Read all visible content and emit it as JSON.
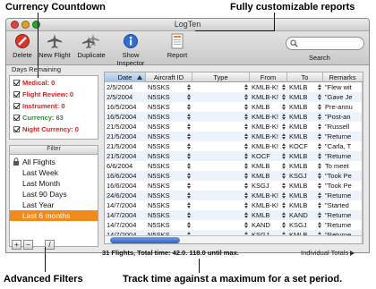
{
  "callouts": {
    "currency": "Currency Countdown",
    "custom_reports": "Fully customizable reports",
    "filters": "Advanced Filters",
    "track": "Track time against a maximum for a set period."
  },
  "window": {
    "title": "LogTen"
  },
  "toolbar": {
    "buttons": [
      {
        "label": "Delete",
        "icon": "delete-icon"
      },
      {
        "label": "New Flight",
        "icon": "airplane-icon"
      },
      {
        "label": "Duplicate",
        "icon": "duplicate-airplane-icon"
      },
      {
        "label": "Show Inspector",
        "icon": "info-icon"
      },
      {
        "label": "Report",
        "icon": "report-icon"
      }
    ],
    "search_label": "Search",
    "search_placeholder": "",
    "colors": {
      "delete": "#d9362b",
      "info": "#2f6fd1",
      "report": "#e8853a"
    }
  },
  "currency": {
    "heading": "Days Remaining",
    "items": [
      {
        "label": "Medical: 0",
        "color": "#d62020"
      },
      {
        "label": "Flight Review: 0",
        "color": "#d62020"
      },
      {
        "label": "Instrument: 0",
        "color": "#d62020"
      },
      {
        "label": "Currency: 63",
        "color": "#2f8a2f"
      },
      {
        "label": "Night Currency: 0",
        "color": "#d62020"
      }
    ]
  },
  "filter": {
    "heading": "Filter",
    "items": [
      {
        "label": "All Flights",
        "selected": false
      },
      {
        "label": "Last Week",
        "selected": false
      },
      {
        "label": "Last Month",
        "selected": false
      },
      {
        "label": "Last 90 Days",
        "selected": false
      },
      {
        "label": "Last Year",
        "selected": false
      },
      {
        "label": "Last 6 months",
        "selected": true
      }
    ],
    "selection_color": "#f08a1c",
    "buttons": [
      "+",
      "−",
      "/"
    ]
  },
  "table": {
    "columns": [
      "Date",
      "Aircraft ID",
      "Type",
      "From",
      "To",
      "Remarks"
    ],
    "rows": [
      [
        "2/5/2004",
        "N5SKS",
        "",
        "KMLB-K!",
        "KMLB",
        "\"Flew wit"
      ],
      [
        "2/5/2004",
        "N5SKS",
        "",
        "KMLB-K!",
        "KMLB",
        "\"Gave Je"
      ],
      [
        "16/5/2004",
        "N5SKS",
        "",
        "KMLB",
        "KMLB",
        "Pre-annu"
      ],
      [
        "16/5/2004",
        "N5SKS",
        "",
        "KMLB-K!",
        "KMLB",
        "\"Post-an"
      ],
      [
        "21/5/2004",
        "N5SKS",
        "",
        "KMLB-K!",
        "KMLB",
        "\"Russell"
      ],
      [
        "21/5/2004",
        "N5SKS",
        "",
        "KMLB-K!",
        "KMLB",
        "\"Returne"
      ],
      [
        "21/5/2004",
        "N5SKS",
        "",
        "KMLB-K!",
        "KOCF",
        "\"Carla, T"
      ],
      [
        "21/5/2004",
        "N5SKS",
        "",
        "KOCF",
        "KMLB",
        "\"Returne"
      ],
      [
        "6/6/2004",
        "N5SKS",
        "",
        "KMLB",
        "KMLB",
        "To meet"
      ],
      [
        "16/6/2004",
        "N5SKS",
        "",
        "KMLB",
        "KSGJ",
        "\"Took Pe"
      ],
      [
        "16/6/2004",
        "N5SKS",
        "",
        "KSGJ",
        "KMLB",
        "\"Took Pe"
      ],
      [
        "24/6/2004",
        "N5SKS",
        "",
        "KMLB-K!",
        "KMLB",
        "\"Returne"
      ],
      [
        "14/7/2004",
        "N5SKS",
        "",
        "KMLB-K!",
        "KMLB",
        "\"Started"
      ],
      [
        "14/7/2004",
        "N5SKS",
        "",
        "KMLB",
        "KAND",
        "\"Returne"
      ],
      [
        "14/7/2004",
        "N5SKS",
        "",
        "KAND",
        "KSGJ",
        "\"Returne"
      ],
      [
        "14/7/2004",
        "N5SKS",
        "",
        "KSGJ",
        "KMLB",
        "\"Returne"
      ]
    ]
  },
  "status": {
    "summary": "31 Flights, Total time: 42.0. 118.0 until max.",
    "totals_label": "Individual Totals"
  }
}
